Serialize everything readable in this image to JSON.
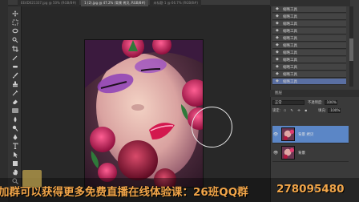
{
  "document_tabs": [
    {
      "label": "EE4D021337.jpg @ 50% (RGB/8#)",
      "active": false
    },
    {
      "label": "1 (2).jpg @ 47.2% (背景 拷贝, RGB/8#)",
      "active": true
    },
    {
      "label": "未标题-1 @ 66.7% (RGB/8#)",
      "active": false
    }
  ],
  "history": {
    "items": [
      {
        "label": "缩略工具"
      },
      {
        "label": "缩略工具"
      },
      {
        "label": "缩略工具"
      },
      {
        "label": "缩略工具"
      },
      {
        "label": "缩略工具"
      },
      {
        "label": "缩略工具"
      },
      {
        "label": "缩略工具"
      },
      {
        "label": "缩略工具"
      },
      {
        "label": "缩略工具"
      },
      {
        "label": "缩略工具"
      },
      {
        "label": "缩略工具"
      }
    ]
  },
  "layers": {
    "panel_title": "图层",
    "blend_mode": "正常",
    "opacity_label": "不透明度:",
    "opacity_value": "100%",
    "lock_label": "锁定:",
    "fill_label": "填充:",
    "fill_value": "100%",
    "items": [
      {
        "name": "背景 拷贝",
        "selected": true
      },
      {
        "name": "背景",
        "selected": false
      }
    ]
  },
  "banner": {
    "text": "加群可以获得更多免费直播在线体验课：26班QQ群",
    "qq_number": "278095480"
  },
  "colors": {
    "banner_text": "#f2a64a",
    "selection": "#5b86c6"
  }
}
